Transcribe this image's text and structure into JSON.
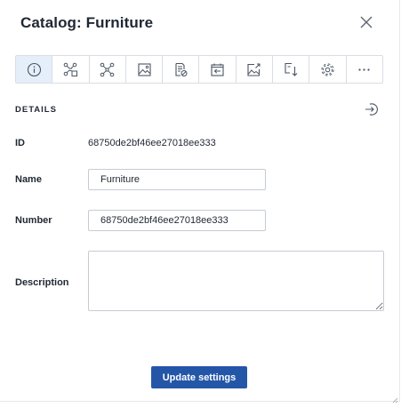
{
  "header": {
    "title": "Catalog: Furniture"
  },
  "toolbar": {
    "items": [
      {
        "icon": "info-icon",
        "active": true
      },
      {
        "icon": "hierarchy-icon"
      },
      {
        "icon": "network-icon"
      },
      {
        "icon": "image-icon"
      },
      {
        "icon": "document-block-icon"
      },
      {
        "icon": "import-icon"
      },
      {
        "icon": "image-export-icon"
      },
      {
        "icon": "download-icon"
      },
      {
        "icon": "settings-gear-icon"
      },
      {
        "icon": "more-icon"
      }
    ]
  },
  "details": {
    "section_label": "DETAILS",
    "id_label": "ID",
    "id_value": "68750de2bf46ee27018ee333",
    "name_label": "Name",
    "name_value": "Furniture",
    "number_label": "Number",
    "number_value": "68750de2bf46ee27018ee333",
    "description_label": "Description",
    "description_value": ""
  },
  "footer": {
    "update_label": "Update settings"
  },
  "colors": {
    "accent": "#2456a8",
    "active_tab": "#e5effa",
    "border": "#d9dde3"
  }
}
